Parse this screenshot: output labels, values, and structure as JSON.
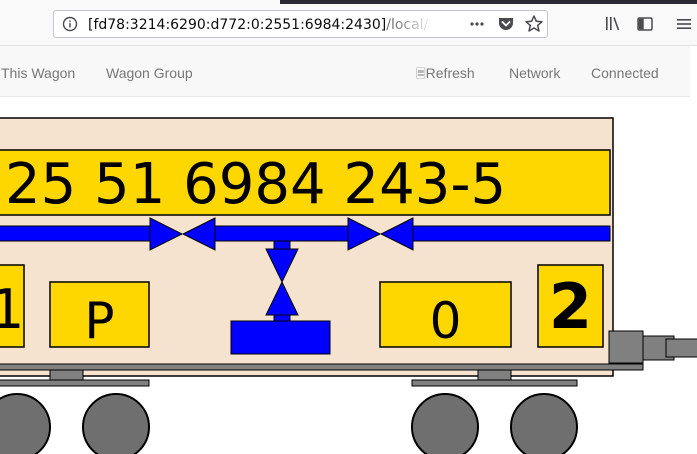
{
  "browser": {
    "url": "[fd78:3214:6290:d772:0:2551:6984:2430]",
    "url_path": "/local/fulls",
    "icons": [
      "info-icon",
      "page-actions-icon",
      "pocket-icon",
      "star-icon",
      "library-icon",
      "sidebar-icon",
      "menu-icon"
    ]
  },
  "nav": {
    "this_wagon": "This Wagon",
    "wagon_group": "Wagon Group",
    "refresh_glyph": "🗏",
    "refresh": "Refresh",
    "network": "Network",
    "connected": "Connected"
  },
  "wagon": {
    "number": "25 51 6984 243-5",
    "left_partial": "1",
    "brake_regime": "P",
    "counter": "0",
    "class": "2",
    "colors": {
      "body": "#f5e3d0",
      "plate": "#ffd700",
      "brake_pipe": "#0000ff",
      "chassis": "#808080"
    }
  }
}
